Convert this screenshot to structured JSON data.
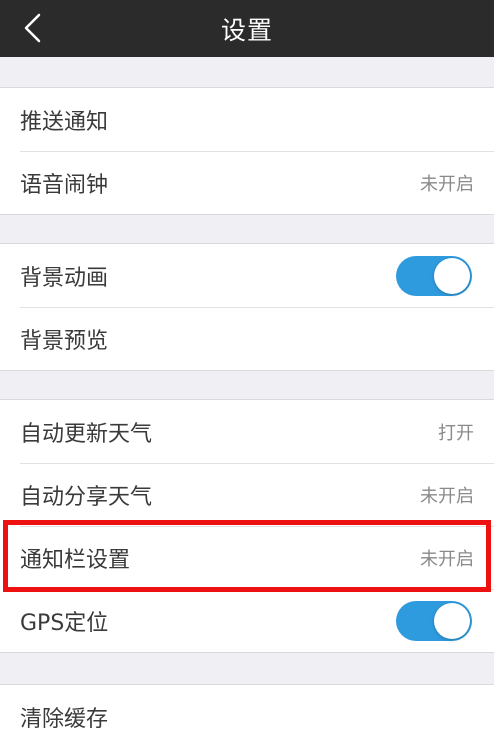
{
  "header": {
    "title": "设置",
    "back_icon": "chevron-left-icon"
  },
  "groups": [
    {
      "items": [
        {
          "label": "推送通知",
          "value": ""
        },
        {
          "label": "语音闹钟",
          "value": "未开启"
        }
      ]
    },
    {
      "items": [
        {
          "label": "背景动画",
          "toggle": true
        },
        {
          "label": "背景预览",
          "value": ""
        }
      ]
    },
    {
      "items": [
        {
          "label": "自动更新天气",
          "value": "打开"
        },
        {
          "label": "自动分享天气",
          "value": "未开启"
        },
        {
          "label": "通知栏设置",
          "value": "未开启",
          "highlighted": true
        },
        {
          "label": "GPS定位",
          "toggle": true
        }
      ]
    },
    {
      "items": [
        {
          "label": "清除缓存",
          "value": ""
        }
      ]
    }
  ],
  "colors": {
    "topbar": "#2b2b2b",
    "toggle_on": "#2f9bdf",
    "highlight_border": "#ee1111",
    "background": "#efeff4"
  }
}
